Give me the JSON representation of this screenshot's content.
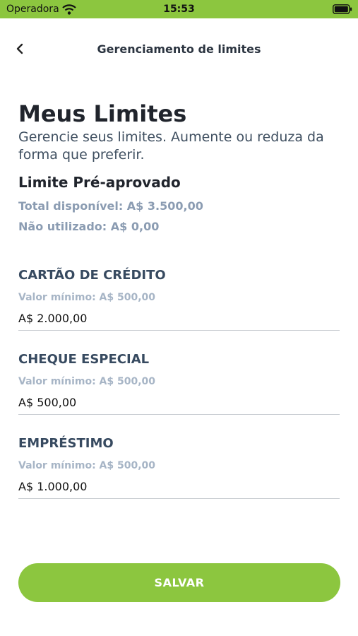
{
  "status_bar": {
    "carrier": "Operadora",
    "time": "15:53"
  },
  "nav": {
    "title": "Gerenciamento de limites",
    "back_icon": "chevron-left-icon"
  },
  "header": {
    "title": "Meus Limites",
    "subtitle": "Gerencie seus limites. Aumente ou reduza da forma que preferir."
  },
  "preapproved": {
    "title": "Limite Pré-aprovado",
    "total": "Total disponível: A$ 3.500,00",
    "unused": "Não utilizado: A$ 0,00"
  },
  "limits": [
    {
      "label": "CARTÃO DE CRÉDITO",
      "min": "Valor mínimo: A$ 500,00",
      "value": "A$ 2.000,00"
    },
    {
      "label": "CHEQUE ESPECIAL",
      "min": "Valor mínimo: A$ 500,00",
      "value": "A$ 500,00"
    },
    {
      "label": "EMPRÉSTIMO",
      "min": "Valor mínimo: A$ 500,00",
      "value": "A$ 1.000,00"
    }
  ],
  "actions": {
    "save": "SALVAR"
  },
  "colors": {
    "accent": "#8cc63f",
    "heading": "#20242c",
    "muted": "#8b9cb2"
  }
}
